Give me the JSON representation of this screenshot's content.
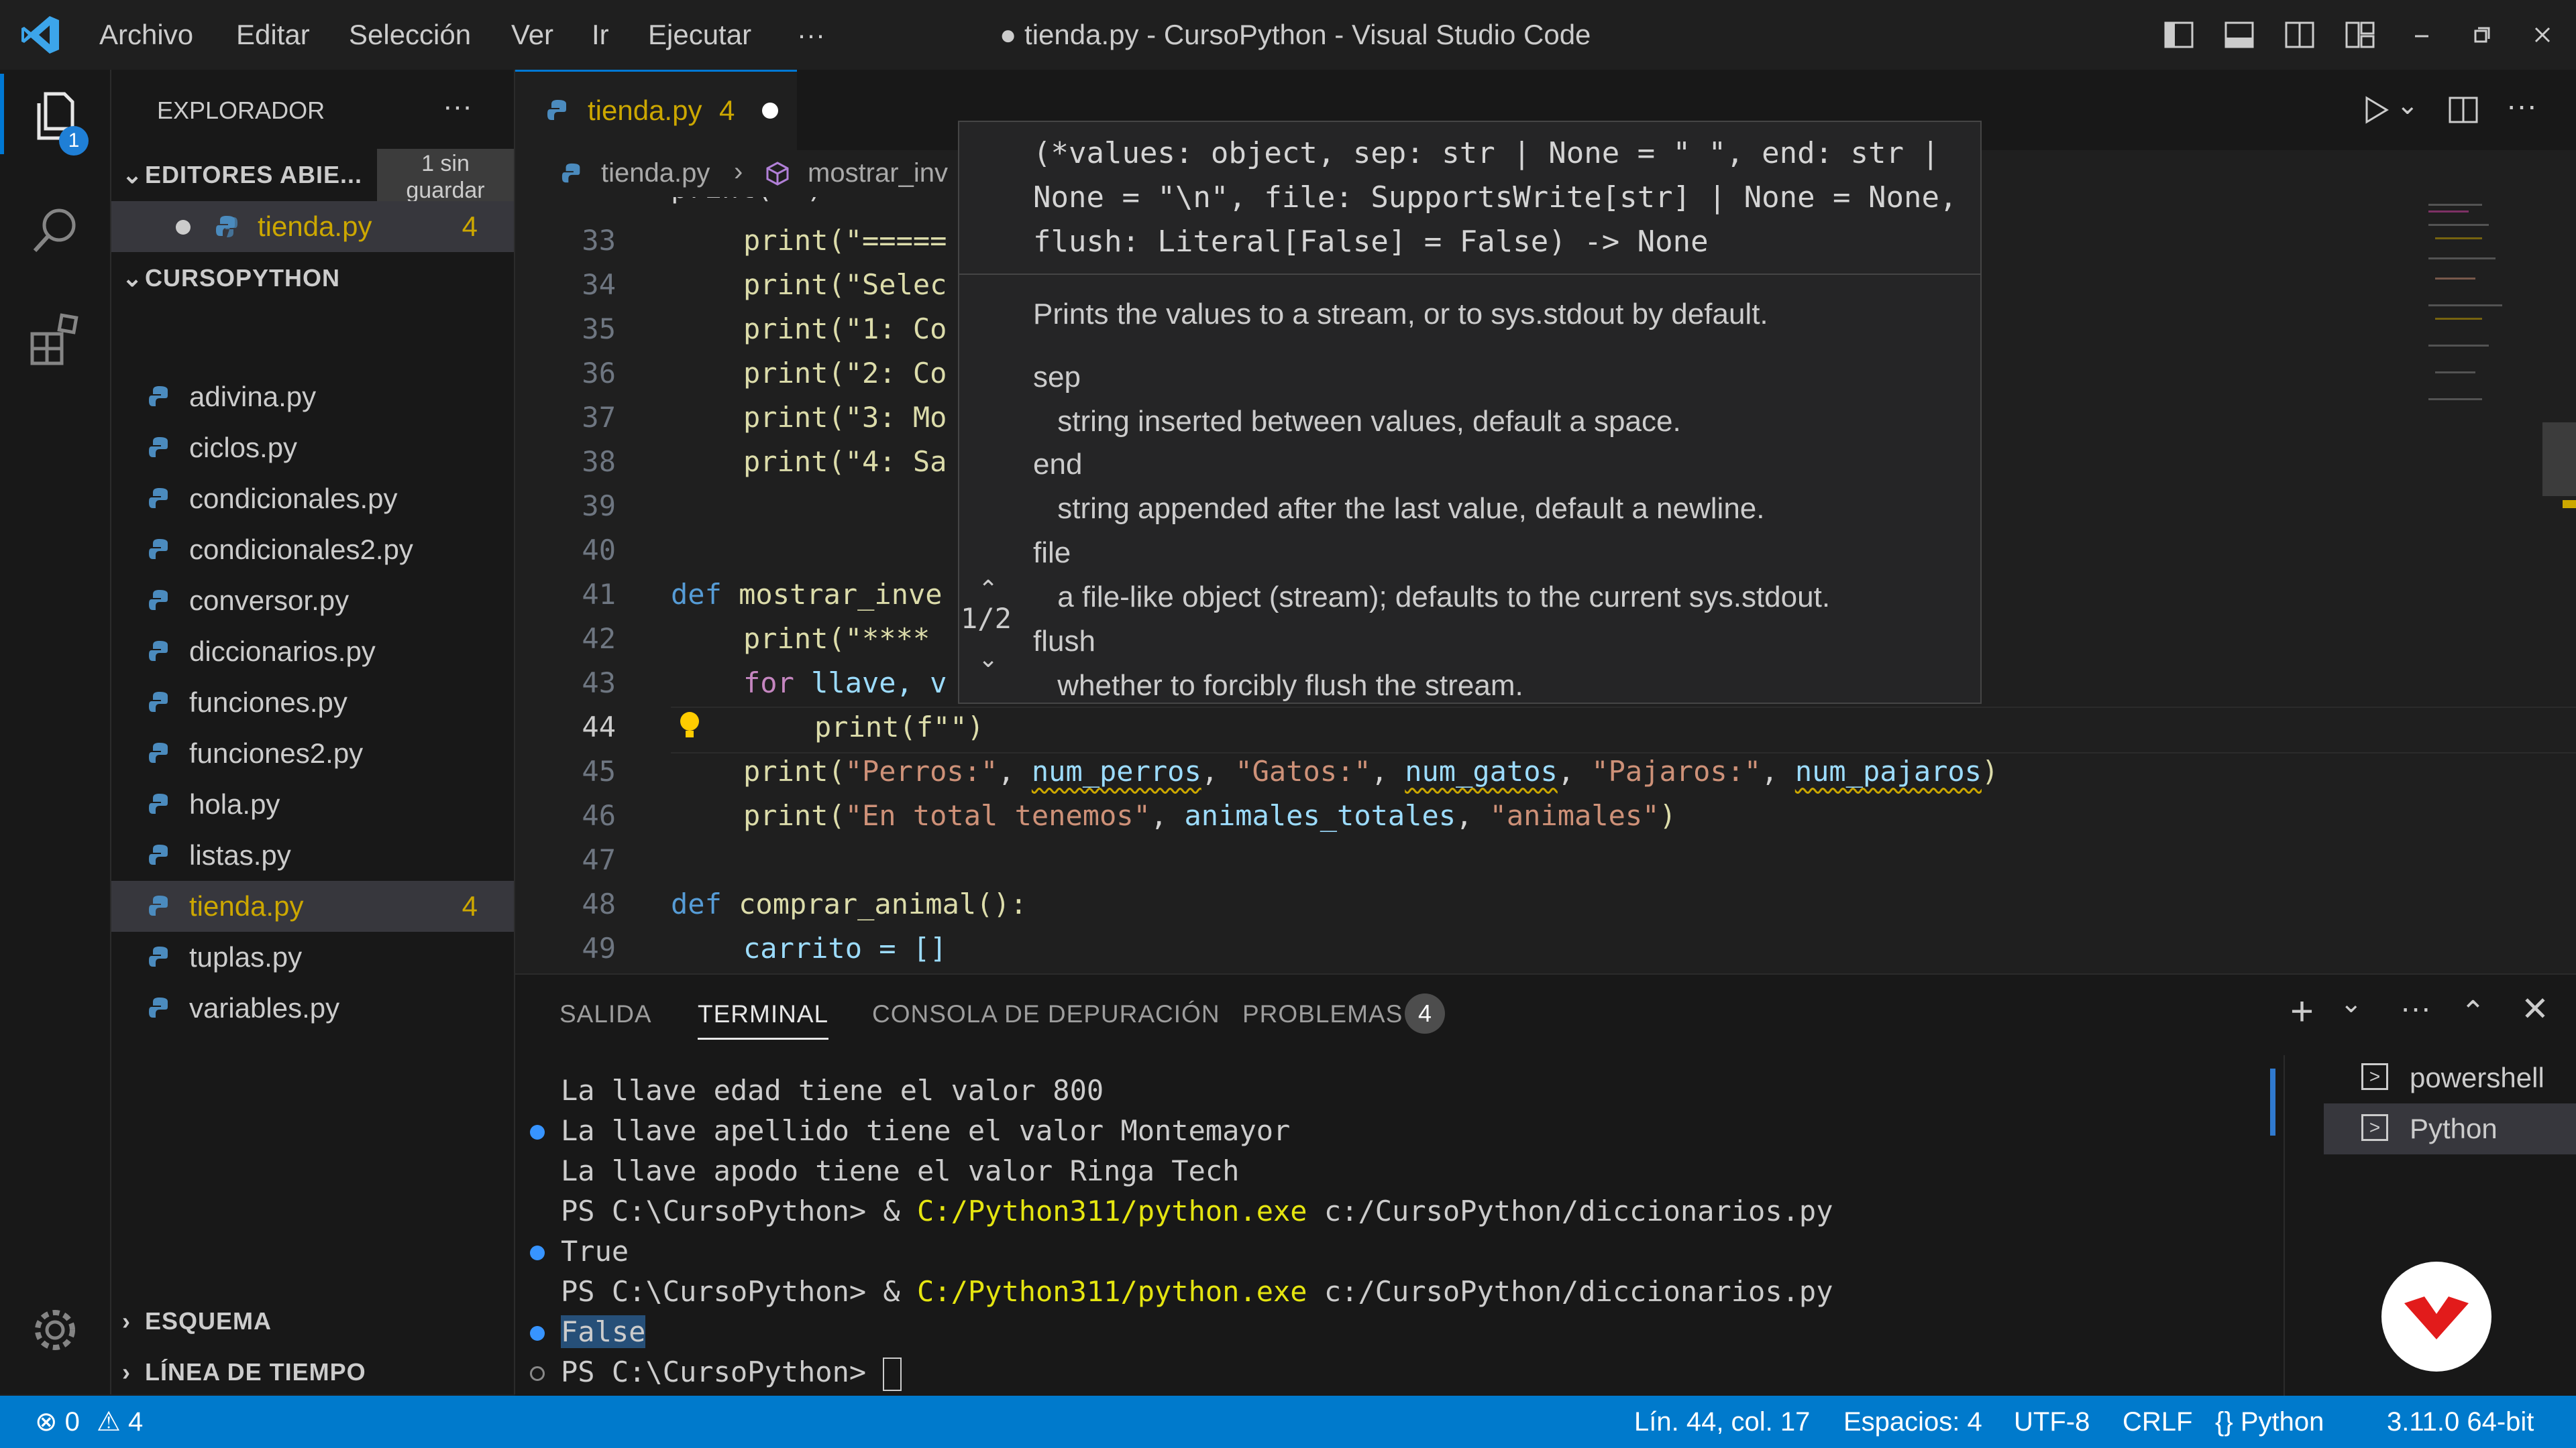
{
  "titlebar": {
    "menus": [
      "Archivo",
      "Editar",
      "Selección",
      "Ver",
      "Ir",
      "Ejecutar",
      "···"
    ],
    "title": "● tienda.py - CursoPython - Visual Studio Code"
  },
  "activity": {
    "explorer_badge": "1"
  },
  "sidebar": {
    "header": "EXPLORADOR",
    "more": "···",
    "open_editors": "EDITORES ABIE...",
    "unsaved_line1": "1 sin",
    "unsaved_line2": "guardar",
    "open_file": "tienda.py",
    "open_file_count": "4",
    "project": "CURSOPYTHON",
    "files": [
      {
        "name": "adivina.py",
        "count": ""
      },
      {
        "name": "ciclos.py",
        "count": ""
      },
      {
        "name": "condicionales.py",
        "count": ""
      },
      {
        "name": "condicionales2.py",
        "count": ""
      },
      {
        "name": "conversor.py",
        "count": ""
      },
      {
        "name": "diccionarios.py",
        "count": ""
      },
      {
        "name": "funciones.py",
        "count": ""
      },
      {
        "name": "funciones2.py",
        "count": ""
      },
      {
        "name": "hola.py",
        "count": ""
      },
      {
        "name": "listas.py",
        "count": ""
      },
      {
        "name": "tienda.py",
        "count": "4"
      },
      {
        "name": "tuplas.py",
        "count": ""
      },
      {
        "name": "variables.py",
        "count": ""
      }
    ],
    "outline": "ESQUEMA",
    "timeline": "LÍNEA DE TIEMPO"
  },
  "editor": {
    "tab_label": "tienda.py",
    "tab_count": "4",
    "breadcrumb_file": "tienda.py",
    "breadcrumb_symbol": "mostrar_inv",
    "line_numbers": [
      "33",
      "34",
      "35",
      "36",
      "37",
      "38",
      "39",
      "40",
      "41",
      "42",
      "43",
      "44",
      "45",
      "46",
      "47",
      "48",
      "49"
    ],
    "lines": {
      "l33": "print(\"=====",
      "l34": "print(\"Selec",
      "l35": "print(\"1: Co",
      "l36": "print(\"2: Co",
      "l37": "print(\"3: Mo",
      "l38": "print(\"4: Sa",
      "l41_kw": "def",
      "l41_fn": " mostrar_inve",
      "l42": "print(\"****",
      "l43_kw": "for",
      "l43_rest": " llave, v",
      "l44": "print(f\"\")",
      "l45": {
        "a": "print(\"Perros:\", ",
        "b": "num_perros",
        ",c": "",
        "c": ", \"Gatos:\", ",
        "d": "num_gatos",
        "e": ", \"Pajaros:\", ",
        "f": "num_pajaros",
        "g": ")"
      },
      "l46": "print(\"En total tenemos\", animales_totales, \"animales\")",
      "l48_kw": "def",
      "l48_fn": " comprar_animal():",
      "l49": "carrito = []"
    }
  },
  "hover": {
    "sig1": "(*values: object, sep: str | None = \" \", end: str |",
    "sig2": "None = \"\\n\", file: SupportsWrite[str] | None = None,",
    "sig3": "flush: Literal[False] = False) -> None",
    "counter": "1/2",
    "doc": "Prints the values to a stream, or to sys.stdout by default.",
    "params": [
      {
        "name": "sep",
        "desc": " string inserted between values, default a space."
      },
      {
        "name": "end",
        "desc": " string appended after the last value, default a newline."
      },
      {
        "name": "file",
        "desc": " a file-like object (stream); defaults to the current sys.stdout."
      },
      {
        "name": "flush",
        "desc": " whether to forcibly flush the stream."
      }
    ]
  },
  "panel": {
    "tabs": [
      "SALIDA",
      "TERMINAL",
      "CONSOLA DE DEPURACIÓN",
      "PROBLEMAS"
    ],
    "problems_count": "4",
    "terminal_lines": [
      "La llave edad tiene el valor 800",
      "La llave apellido tiene el valor Montemayor",
      "La llave apodo tiene el valor Ringa Tech",
      "PS C:\\CursoPython> & ",
      "True",
      "PS C:\\CursoPython> & ",
      "False",
      "PS C:\\CursoPython> "
    ],
    "exe": "C:/Python311/python.exe",
    "script": " c:/CursoPython/diccionarios.py",
    "terminals": [
      "powershell",
      "Python"
    ]
  },
  "status": {
    "errors": "0",
    "warnings": "4",
    "position": "Lín. 44, col. 17",
    "spaces": "Espacios: 4",
    "encoding": "UTF-8",
    "eol": "CRLF",
    "language": "Python",
    "version": "3.11.0 64-bit"
  },
  "colors": {
    "accent": "#007acc",
    "warning": "#cca700",
    "keyword": "#569cd6",
    "string": "#ce9178"
  }
}
